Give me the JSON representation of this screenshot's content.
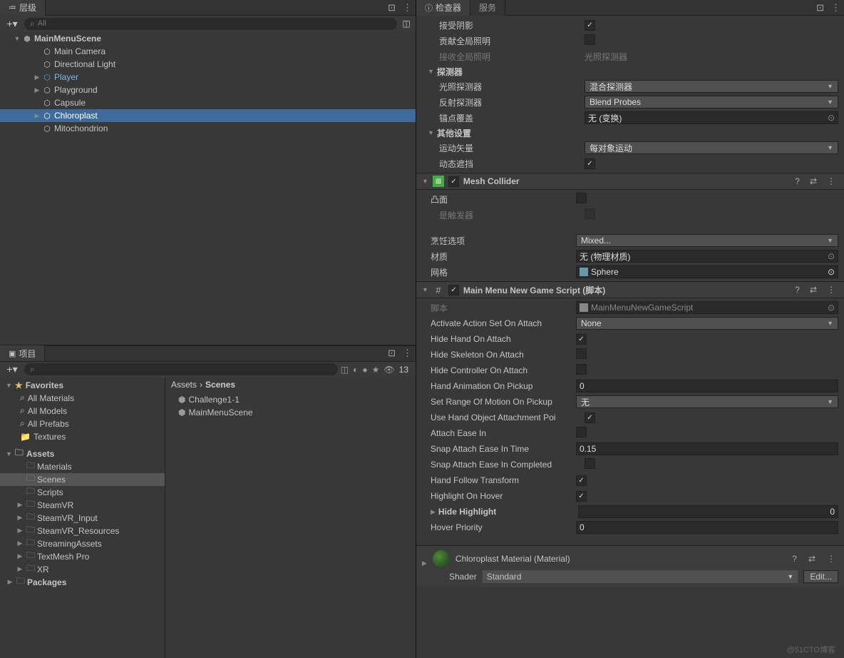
{
  "hierarchy": {
    "tab": "层级",
    "search_placeholder": "All",
    "scene": "MainMenuScene",
    "items": [
      {
        "name": "Main Camera",
        "indent": 2,
        "blue": false
      },
      {
        "name": "Directional Light",
        "indent": 2,
        "blue": false
      },
      {
        "name": "Player",
        "indent": 2,
        "blue": true,
        "expandable": true
      },
      {
        "name": "Playground",
        "indent": 2,
        "blue": false,
        "expandable": true
      },
      {
        "name": "Capsule",
        "indent": 2,
        "blue": false
      },
      {
        "name": "Chloroplast",
        "indent": 2,
        "blue": false,
        "selected": true,
        "expandable": true
      },
      {
        "name": "Mitochondrion",
        "indent": 2,
        "blue": false
      }
    ]
  },
  "project": {
    "tab": "项目",
    "favorites": "Favorites",
    "fav_items": [
      "All Materials",
      "All Models",
      "All Prefabs"
    ],
    "textures": "Textures",
    "assets": "Assets",
    "folders": [
      "Materials",
      "Scenes",
      "Scripts",
      "SteamVR",
      "SteamVR_Input",
      "SteamVR_Resources",
      "StreamingAssets",
      "TextMesh Pro",
      "XR"
    ],
    "packages": "Packages",
    "breadcrumb": [
      "Assets",
      "Scenes"
    ],
    "scenes": [
      "Challenge1-1",
      "MainMenuScene"
    ],
    "hidden_count": "13"
  },
  "inspector": {
    "tab_inspector": "检查器",
    "tab_services": "服务",
    "receive_shadows": "接受阴影",
    "contribute_gi": "贡献全局照明",
    "receive_gi": "接收全局照明",
    "receive_gi_value": "光照探测器",
    "probes": "探测器",
    "light_probes": "光照探测器",
    "light_probes_value": "混合探测器",
    "reflection_probes": "反射探测器",
    "reflection_probes_value": "Blend Probes",
    "anchor_override": "锚点覆盖",
    "anchor_override_value": "无 (变换)",
    "additional_settings": "其他设置",
    "motion_vectors": "运动矢量",
    "motion_vectors_value": "每对象运动",
    "dynamic_occlusion": "动态遮挡",
    "mesh_collider": "Mesh Collider",
    "convex": "凸面",
    "is_trigger": "是触发器",
    "cooking_options": "烹饪选项",
    "cooking_options_value": "Mixed...",
    "material": "材质",
    "material_value": "无 (物理材质)",
    "mesh": "网格",
    "mesh_value": "Sphere",
    "script_component": "Main Menu New Game Script   (脚本)",
    "script_label": "脚本",
    "script_value": "MainMenuNewGameScript",
    "activate_action": "Activate Action Set On Attach",
    "activate_action_value": "None",
    "hide_hand": "Hide Hand On Attach",
    "hide_skeleton": "Hide Skeleton On Attach",
    "hide_controller": "Hide Controller On Attach",
    "hand_animation": "Hand Animation On Pickup",
    "hand_animation_value": "0",
    "set_range": "Set Range Of Motion On Pickup",
    "set_range_value": "无",
    "use_hand_object": "Use Hand Object Attachment Poi",
    "attach_ease": "Attach Ease In",
    "snap_attach_time": "Snap Attach Ease In Time",
    "snap_attach_time_value": "0.15",
    "snap_attach_completed": "Snap Attach Ease In Completed",
    "hand_follow": "Hand Follow Transform",
    "highlight_hover": "Highlight On Hover",
    "hide_highlight": "Hide Highlight",
    "hide_highlight_value": "0",
    "hover_priority": "Hover Priority",
    "hover_priority_value": "0",
    "chloroplast_mat": "Chloroplast Material (Material)",
    "shader_label": "Shader",
    "shader_value": "Standard",
    "edit_btn": "Edit..."
  },
  "watermark": "@51CTO博客"
}
